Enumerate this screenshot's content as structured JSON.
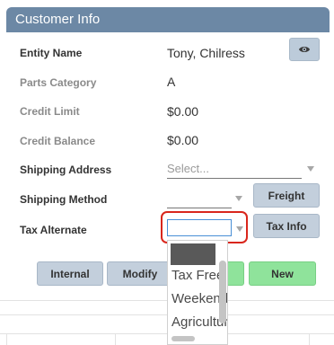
{
  "panel": {
    "title": "Customer Info"
  },
  "fields": {
    "entity_name": {
      "label": "Entity Name",
      "value": "Tony, Chilress"
    },
    "parts_category": {
      "label": "Parts Category",
      "value": "A"
    },
    "credit_limit": {
      "label": "Credit Limit",
      "value": "$0.00"
    },
    "credit_balance": {
      "label": "Credit Balance",
      "value": "$0.00"
    },
    "shipping_address": {
      "label": "Shipping Address",
      "placeholder": "Select..."
    },
    "shipping_method": {
      "label": "Shipping Method",
      "value": ""
    },
    "tax_alternate": {
      "label": "Tax Alternate",
      "value": ""
    }
  },
  "buttons": {
    "freight": "Freight",
    "tax_info": "Tax Info",
    "internal": "Internal",
    "modify": "Modify",
    "new": "New"
  },
  "tax_dropdown": {
    "options": [
      "Tax Free",
      "Weekend",
      "Agriculture"
    ]
  },
  "icons": {
    "eye": "eye-icon",
    "caret": "chevron-down-icon"
  },
  "colors": {
    "header_bg": "#6c88a5",
    "button_bg": "#c3cfdc",
    "new_button_bg": "#8fe39b",
    "highlight_border": "#d9261c"
  }
}
